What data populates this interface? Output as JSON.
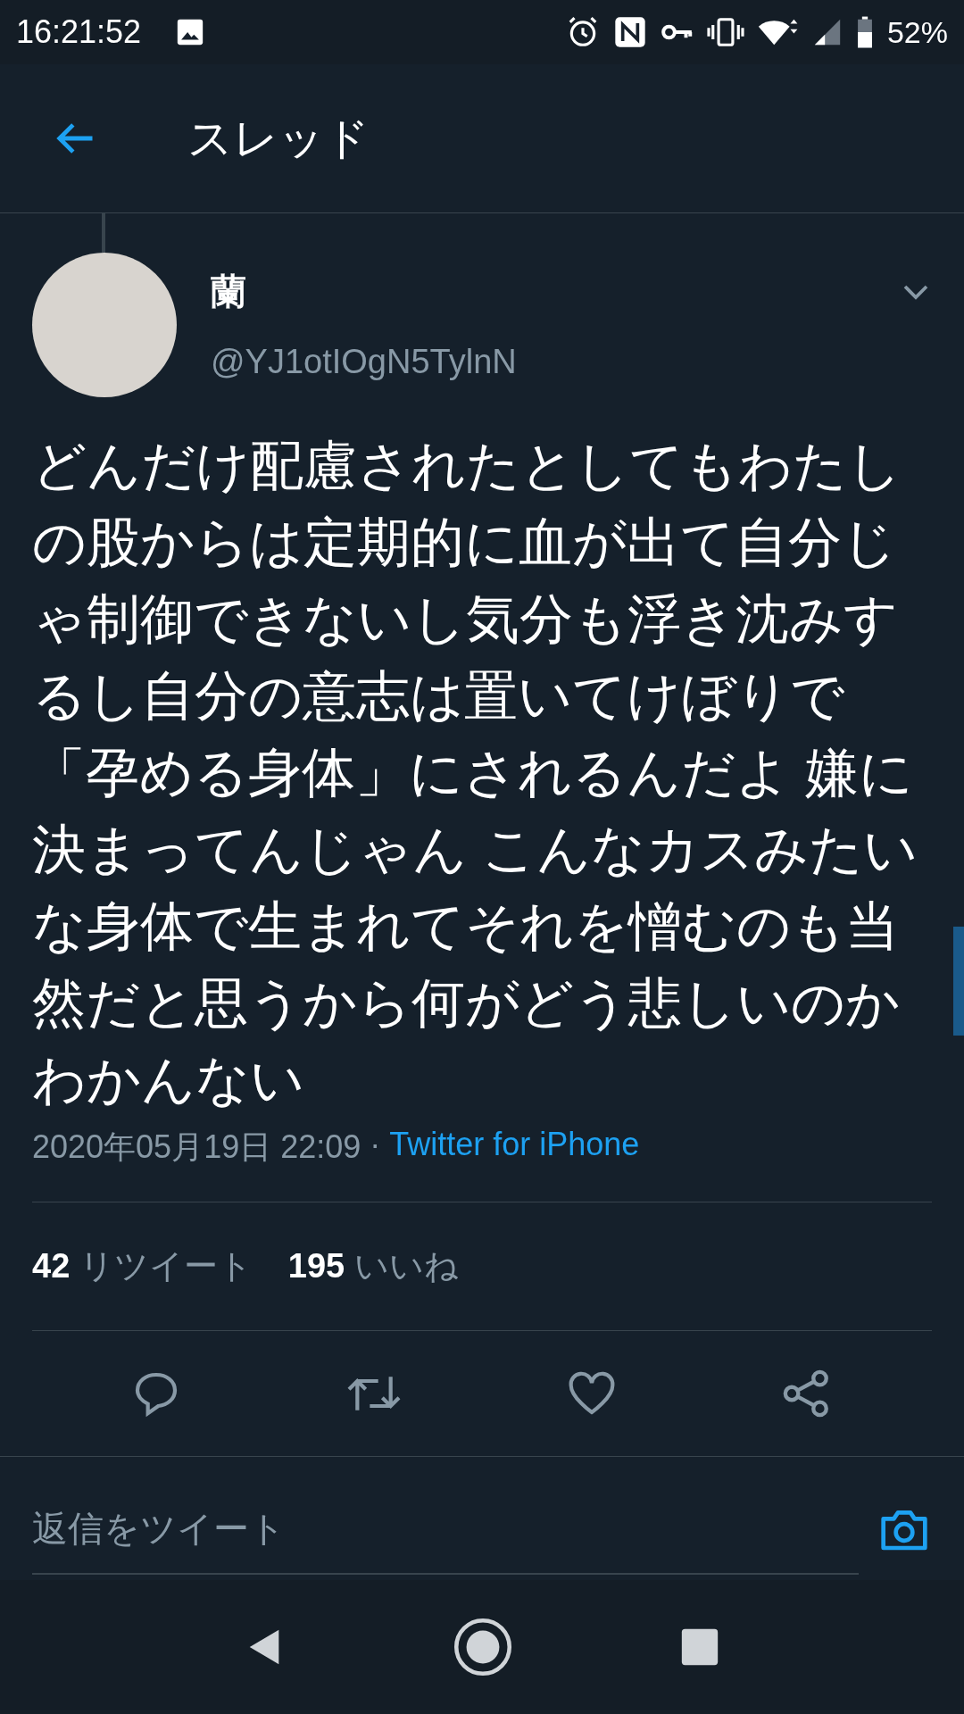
{
  "status_bar": {
    "time": "16:21:52",
    "battery": "52%"
  },
  "header": {
    "title": "スレッド"
  },
  "tweet": {
    "name": "蘭",
    "handle": "@YJ1otIOgN5TylnN",
    "text": "どんだけ配慮されたとしてもわたしの股からは定期的に血が出て自分じゃ制御できないし気分も浮き沈みするし自分の意志は置いてけぼりで「孕める身体」にされるんだよ 嫌に決まってんじゃん こんなカスみたいな身体で生まれてそれを憎むのも当然だと思うから何がどう悲しいのかわかんない",
    "date": "2020年05月19日 22:09",
    "separator": "·",
    "source": "Twitter for iPhone"
  },
  "stats": [
    {
      "count": "42",
      "label": "リツイート"
    },
    {
      "count": "195",
      "label": "いいね"
    }
  ],
  "actions": [
    {
      "kind": "reply"
    },
    {
      "kind": "retweet"
    },
    {
      "kind": "like"
    },
    {
      "kind": "share"
    }
  ],
  "reply_field": {
    "placeholder": "返信をツイート"
  }
}
